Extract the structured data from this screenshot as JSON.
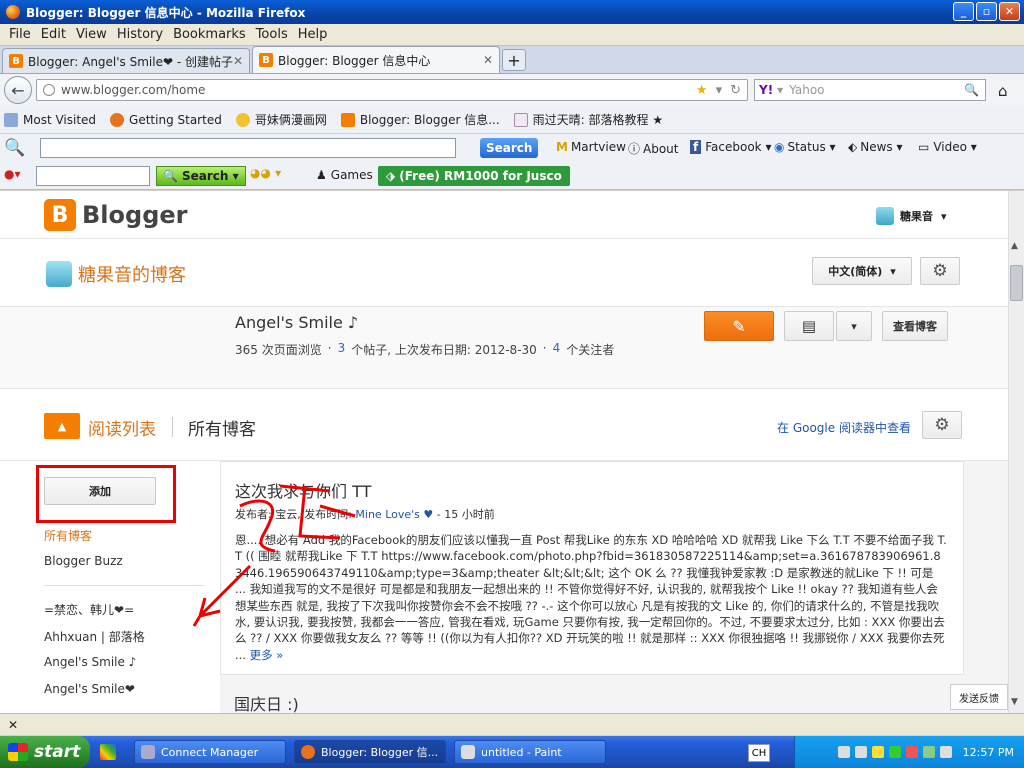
{
  "window": {
    "title": "Blogger: Blogger 信息中心 - Mozilla Firefox"
  },
  "menu": [
    "File",
    "Edit",
    "View",
    "History",
    "Bookmarks",
    "Tools",
    "Help"
  ],
  "tabs": [
    {
      "label": "Blogger: Angel's Smile❤ - 创建帖子"
    },
    {
      "label": "Blogger: Blogger 信息中心"
    }
  ],
  "nav": {
    "url": "www.blogger.com/home",
    "search_placeholder": "Yahoo"
  },
  "bookmarks": [
    {
      "label": "Most Visited"
    },
    {
      "label": "Getting Started"
    },
    {
      "label": "哥妹俩漫画网"
    },
    {
      "label": "Blogger: Blogger 信息..."
    },
    {
      "label": "雨过天晴: 部落格教程 ★"
    }
  ],
  "toolbar1": {
    "search_label": "Search",
    "items": [
      "Martview",
      "About",
      "Facebook",
      "Status",
      "News",
      "Video"
    ]
  },
  "toolbar2": {
    "search_label": "Search",
    "games_label": "Games",
    "promo_label": "(Free) RM1000 for Jusco"
  },
  "blogger": {
    "brand": "Blogger",
    "user": "糖果音",
    "blog_name": "糖果音的博客",
    "lang_btn": "中文(简体)",
    "card": {
      "title": "Angel's Smile ♪",
      "views": "365 次页面浏览",
      "posts_num": "3",
      "posts_text": "个帖子, 上次发布日期: 2012-8-30",
      "followers_num": "4",
      "followers_text": "个关注者",
      "view_blog": "查看博客"
    },
    "reading": {
      "title": "阅读列表",
      "all_blogs": "所有博客",
      "google_reader": "在 Google 阅读器中查看"
    },
    "sidebar": {
      "add_btn": "添加",
      "items": [
        "所有博客",
        "Blogger Buzz",
        "=禁恋、韩儿❤=",
        "Ahhxuan | 部落格",
        "Angel's Smile ♪",
        "Angel's Smile❤"
      ]
    },
    "post": {
      "title": "这次我求与你们 TT",
      "meta_prefix": "发布者: 宝云, 发布时间: ",
      "meta_link": "Mine Love's ♥",
      "meta_suffix": " - 15 小时前",
      "body": "恩.... 想必有 Add 我的Facebook的朋友们应该以懂我一直 Post 帮我Like 的东东 XD 哈哈哈哈 XD 就帮我 Like 下么 T.T 不要不给面子我 T.T (( 围睦 就帮我Like 下 T.T https://www.facebook.com/photo.php?fbid=361830587225114&amp;set=a.361678783906961.83446.196590643749110&amp;type=3&amp;theater &lt;&lt;&lt; 这个 OK 么 ?? 我懂我钟爱家教 :D 是家教迷的就Like 下 !! 可是 ... 我知道我写的文不是很好 可是都是和我朋友一起想出来的 !! 不管你觉得好不好, 认识我的, 就帮我按个 Like !! okay ?? 我知道有些人会想某些东西 就是, 我按了下次我叫你按赞你会不会不按哦 ?? -.- 这个你可以放心 凡是有按我的文 Like 的, 你们的请求什么的, 不管是找我吹水, 要认识我, 要我按赞, 我都会一一答应, 管我在看戏, 玩Game 只要你有按, 我一定帮回你的。不过, 不要要求太过分, 比如 : XXX 你要出去么 ?? / XXX 你要做我女友么 ?? 等等 !! ((你以为有人扣你?? XD 开玩笑的啦 !! 就是那样 :: XXX 你很独据咯 !! 我挪锐你 / XXX 我要你去死 ...",
      "more": "更多 »"
    },
    "post2_title": "国庆日 :)",
    "feedback": "发送反馈"
  },
  "taskbar": {
    "start": "start",
    "tasks": [
      "Connect Manager",
      "Blogger: Blogger 信...",
      "untitled - Paint"
    ],
    "input_lang": "CH",
    "clock": "12:57 PM"
  }
}
